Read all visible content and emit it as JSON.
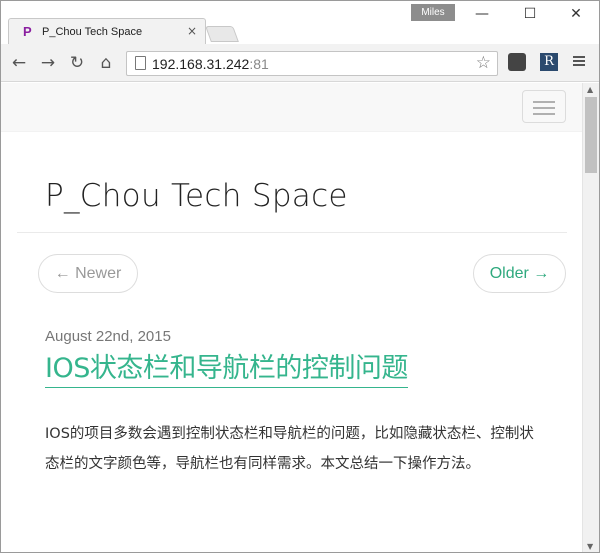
{
  "browser": {
    "tab": {
      "favicon": "P",
      "title": "P_Chou Tech Space",
      "close": "×"
    },
    "user_badge": "Miles",
    "window": {
      "minimize": "—",
      "maximize": "☐",
      "close": "✕"
    },
    "toolbar": {
      "back": "←",
      "forward": "→",
      "reload": "↻",
      "home": "⌂",
      "url_host": "192.168.31.242",
      "url_port": ":81",
      "star": "☆",
      "ext_r": "R"
    }
  },
  "page": {
    "site_title": "P_Chou Tech Space",
    "pager": {
      "newer": "← Newer",
      "older": "Older →"
    },
    "post": {
      "date": "August 22nd, 2015",
      "title": "IOS状态栏和导航栏的控制问题",
      "excerpt": "IOS的项目多数会遇到控制状态栏和导航栏的问题，比如隐藏状态栏、控制状态栏的文字颜色等，导航栏也有同样需求。本文总结一下操作方法。"
    }
  },
  "scrollbar": {
    "up": "▲",
    "down": "▼"
  }
}
